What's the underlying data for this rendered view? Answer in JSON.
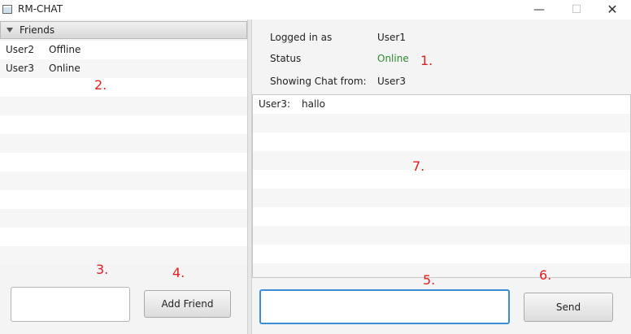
{
  "window": {
    "title": "RM-CHAT",
    "minimize_symbol": "—",
    "maximize_symbol": "☐",
    "close_symbol": "✕"
  },
  "friends": {
    "header": "Friends",
    "rows": [
      {
        "name": "User2",
        "status": "Offline"
      },
      {
        "name": "User3",
        "status": "Online"
      }
    ],
    "add_field_value": "",
    "add_button_label": "Add Friend"
  },
  "info": {
    "logged_in_label": "Logged in as",
    "logged_in_value": "User1",
    "status_label": "Status",
    "status_value": "Online",
    "showing_label": "Showing Chat from:",
    "showing_value": "User3"
  },
  "chat": {
    "messages": [
      {
        "sender": "User3:",
        "text": "hallo"
      }
    ],
    "input_value": "",
    "send_label": "Send"
  },
  "annotations": {
    "n1": "1.",
    "n2": "2.",
    "n3": "3.",
    "n4": "4.",
    "n5": "5.",
    "n6": "6.",
    "n7": "7."
  },
  "colors": {
    "online": "#2b8a2b",
    "annotation": "#e02020",
    "focus_border": "#3a8ed6"
  }
}
